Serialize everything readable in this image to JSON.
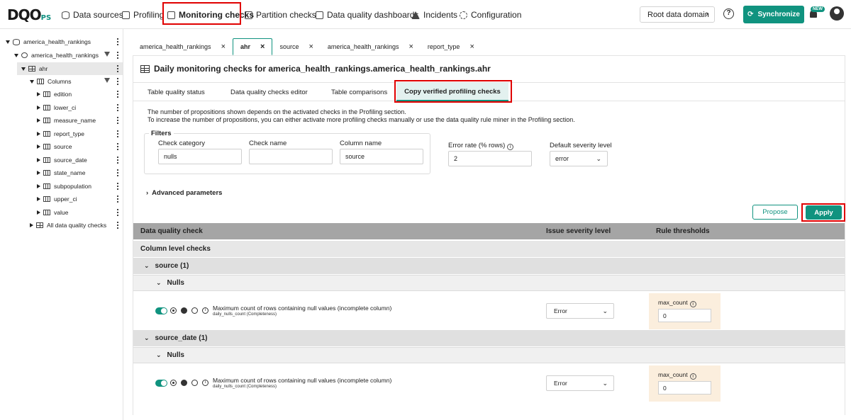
{
  "app": {
    "logo_main": "DQO",
    "logo_suffix": "PS"
  },
  "nav": {
    "items": [
      {
        "label": "Data sources"
      },
      {
        "label": "Profiling"
      },
      {
        "label": "Monitoring checks"
      },
      {
        "label": "Partition checks"
      },
      {
        "label": "Data quality dashboards"
      },
      {
        "label": "Incidents"
      },
      {
        "label": "Configuration"
      }
    ],
    "root_domain": "Root data domain",
    "sync_label": "Synchronize",
    "new_badge": "NEW",
    "help": "?"
  },
  "sidebar": {
    "connection": "america_health_rankings",
    "schema": "america_health_rankings",
    "table": "ahr",
    "columns_label": "Columns",
    "columns": [
      "edition",
      "lower_ci",
      "measure_name",
      "report_type",
      "source",
      "source_date",
      "state_name",
      "subpopulation",
      "upper_ci",
      "value"
    ],
    "all_checks": "All data quality checks"
  },
  "tabs": [
    {
      "label": "america_health_rankings"
    },
    {
      "label": "ahr"
    },
    {
      "label": "source"
    },
    {
      "label": "america_health_rankings"
    },
    {
      "label": "report_type"
    }
  ],
  "page": {
    "title": "Daily monitoring checks for america_health_rankings.america_health_rankings.ahr",
    "subtabs": [
      {
        "label": "Table quality status"
      },
      {
        "label": "Data quality checks editor"
      },
      {
        "label": "Table comparisons"
      },
      {
        "label": "Copy verified profiling checks"
      }
    ],
    "info_line1": "The number of propositions shown depends on the activated checks in the Profiling section.",
    "info_line2": "To increase the number of propositions, you can either activate more profiling checks manually or use the data quality rule miner in the Profiling section.",
    "filters": {
      "title": "Filters",
      "check_category_label": "Check category",
      "check_category_value": "nulls",
      "check_name_label": "Check name",
      "check_name_value": "",
      "column_name_label": "Column name",
      "column_name_value": "source"
    },
    "error_rate_label": "Error rate (% rows)",
    "error_rate_value": "2",
    "severity_label": "Default severity level",
    "severity_value": "error",
    "advanced_label": "Advanced parameters",
    "propose_label": "Propose",
    "apply_label": "Apply"
  },
  "checks_table": {
    "headers": {
      "check": "Data quality check",
      "severity": "Issue severity level",
      "thresholds": "Rule thresholds"
    },
    "section": "Column level checks",
    "groups": [
      {
        "column": "source (1)",
        "category": "Nulls",
        "check_title": "Maximum count of rows containing null values (incomplete column)",
        "check_sub": "daily_nulls_count (Completeness)",
        "severity": "Error",
        "rule_label": "max_count",
        "rule_value": "0"
      },
      {
        "column": "source_date (1)",
        "category": "Nulls",
        "check_title": "Maximum count of rows containing null values (incomplete column)",
        "check_sub": "daily_nulls_count (Completeness)",
        "severity": "Error",
        "rule_label": "max_count",
        "rule_value": "0"
      }
    ]
  }
}
